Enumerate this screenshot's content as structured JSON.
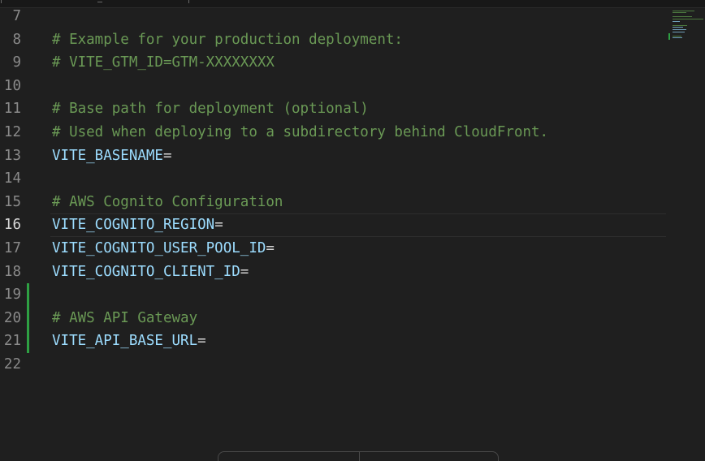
{
  "editor": {
    "lines": [
      {
        "number": "7",
        "segments": []
      },
      {
        "number": "8",
        "segments": [
          {
            "text": "# Example for your production deployment:",
            "kind": "comment"
          }
        ]
      },
      {
        "number": "9",
        "segments": [
          {
            "text": "# VITE_GTM_ID=GTM-XXXXXXXX",
            "kind": "comment"
          }
        ]
      },
      {
        "number": "10",
        "segments": []
      },
      {
        "number": "11",
        "segments": [
          {
            "text": "# Base path for deployment (optional)",
            "kind": "comment"
          }
        ]
      },
      {
        "number": "12",
        "segments": [
          {
            "text": "# Used when deploying to a subdirectory behind CloudFront.",
            "kind": "comment"
          }
        ]
      },
      {
        "number": "13",
        "segments": [
          {
            "text": "VITE_BASENAME",
            "kind": "var"
          },
          {
            "text": "=",
            "kind": "op"
          }
        ]
      },
      {
        "number": "14",
        "segments": []
      },
      {
        "number": "15",
        "segments": [
          {
            "text": "# AWS Cognito Configuration",
            "kind": "comment"
          }
        ]
      },
      {
        "number": "16",
        "segments": [
          {
            "text": "VITE_COGNITO_REGION",
            "kind": "var"
          },
          {
            "text": "=",
            "kind": "op"
          }
        ],
        "current": true
      },
      {
        "number": "17",
        "segments": [
          {
            "text": "VITE_COGNITO_USER_POOL_ID",
            "kind": "var"
          },
          {
            "text": "=",
            "kind": "op"
          }
        ]
      },
      {
        "number": "18",
        "segments": [
          {
            "text": "VITE_COGNITO_CLIENT_ID",
            "kind": "var"
          },
          {
            "text": "=",
            "kind": "op"
          }
        ]
      },
      {
        "number": "19",
        "segments": [],
        "added": true
      },
      {
        "number": "20",
        "segments": [
          {
            "text": "# AWS API Gateway",
            "kind": "comment"
          }
        ],
        "added": true
      },
      {
        "number": "21",
        "segments": [
          {
            "text": "VITE_API_BASE_URL",
            "kind": "var"
          },
          {
            "text": "=",
            "kind": "op"
          }
        ],
        "added": true
      },
      {
        "number": "22",
        "segments": []
      }
    ]
  },
  "colors": {
    "background": "#1f1f1f",
    "comment": "#6a9955",
    "variable": "#9cdcfe",
    "operator": "#d4d4d4",
    "line_number": "#8a8a8a",
    "current_line_number": "#d8d8d8",
    "added_gutter": "#2ea043"
  }
}
